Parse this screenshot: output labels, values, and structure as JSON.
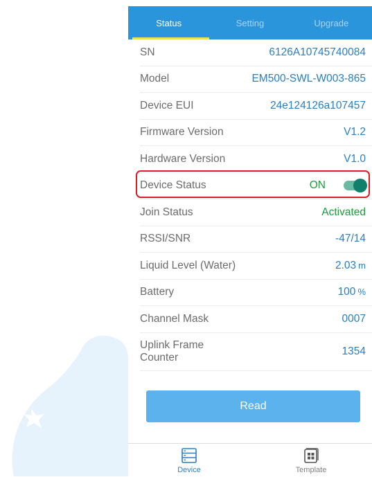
{
  "tabs": [
    {
      "label": "Status",
      "active": true
    },
    {
      "label": "Setting",
      "active": false
    },
    {
      "label": "Upgrade",
      "active": false
    }
  ],
  "rows": {
    "sn": {
      "label": "SN",
      "value": "6126A10745740084"
    },
    "model": {
      "label": "Model",
      "value": "EM500-SWL-W003-865"
    },
    "device_eui": {
      "label": "Device EUI",
      "value": "24e124126a107457"
    },
    "firmware": {
      "label": "Firmware Version",
      "value": "V1.2"
    },
    "hardware": {
      "label": "Hardware Version",
      "value": "V1.0"
    },
    "device_status": {
      "label": "Device Status",
      "value": "ON",
      "toggle_on": true
    },
    "join_status": {
      "label": "Join Status",
      "value": "Activated"
    },
    "rssi": {
      "label": "RSSI/SNR",
      "value": "-47/14"
    },
    "liquid_level": {
      "label": "Liquid Level (Water)",
      "value": "2.03",
      "unit": "m"
    },
    "battery": {
      "label": "Battery",
      "value": "100",
      "unit": "%"
    },
    "channel_mask": {
      "label": "Channel Mask",
      "value": "0007"
    },
    "uplink_counter": {
      "label_line1": "Uplink Frame",
      "label_line2": "Counter",
      "value": "1354"
    }
  },
  "read_button": "Read",
  "bottom_nav": [
    {
      "label": "Device",
      "icon": "device-list-icon",
      "active": true
    },
    {
      "label": "Template",
      "icon": "template-icon",
      "active": false
    }
  ],
  "colors": {
    "header": "#2b95dc",
    "tab_indicator": "#f3e04f",
    "value_blue": "#2a7ec2",
    "value_green": "#1f9a3c",
    "toggle": "#10806a",
    "highlight_red": "#e01a22",
    "read_button": "#5bb2ec"
  }
}
